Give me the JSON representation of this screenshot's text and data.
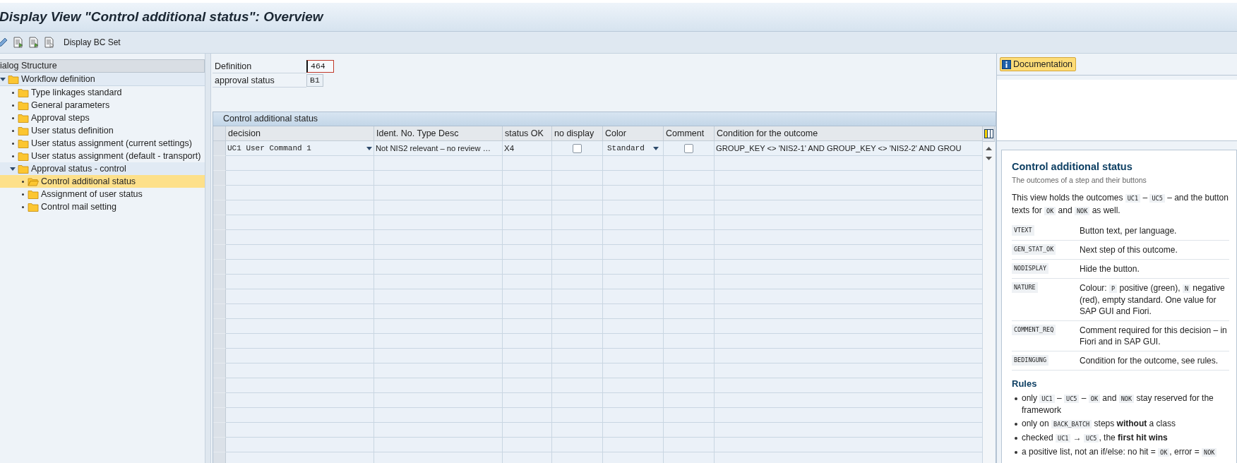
{
  "window": {
    "title": "Display View \"Control additional status\": Overview"
  },
  "toolbar": {
    "button": "Display BC Set"
  },
  "dialog_structure": {
    "title": "ialog Structure",
    "items": [
      {
        "label": "Workflow definition",
        "expanded": true,
        "selected": false,
        "children": [
          {
            "label": "Type linkages standard",
            "selected": false
          },
          {
            "label": "General parameters",
            "selected": false
          },
          {
            "label": "Approval steps",
            "selected": false
          },
          {
            "label": "User status definition",
            "selected": false
          },
          {
            "label": "User status assignment (current settings)",
            "selected": false
          },
          {
            "label": "User status assignment (default - transport)",
            "selected": false
          },
          {
            "label": "Approval status - control",
            "expanded": true,
            "selected": false,
            "children": [
              {
                "label": "Control additional status",
                "selected": true
              },
              {
                "label": "Assignment of user status",
                "selected": false
              },
              {
                "label": "Control mail setting",
                "selected": false
              }
            ]
          }
        ]
      }
    ]
  },
  "header_fields": [
    {
      "label": "Definition",
      "value": "464",
      "focused": true
    },
    {
      "label": "approval status",
      "value": "B1",
      "focused": false
    }
  ],
  "table": {
    "title": "Control additional status",
    "columns": [
      "decision",
      "Ident. No. Type Desc",
      "status OK",
      "no display",
      "Color",
      "Comment",
      "Condition for the outcome"
    ],
    "rows": [
      {
        "decision": "UC1 User Command 1",
        "ident": "Not NIS2 relevant – no review …",
        "status_ok": "X4",
        "no_display": false,
        "color_option": "Standard",
        "comment": false,
        "condition": "GROUP_KEY <> 'NIS2-1' AND GROUP_KEY <> 'NIS2-2' AND GROU"
      }
    ]
  },
  "documentation": {
    "button": "Documentation",
    "title": "Control additional status",
    "subtitle": "The outcomes of a step and their buttons",
    "intro": [
      {
        "kind": "text",
        "text": "This view holds the outcomes "
      },
      {
        "kind": "code",
        "text": "UC1"
      },
      {
        "kind": "text",
        "text": " – "
      },
      {
        "kind": "code",
        "text": "UC5"
      },
      {
        "kind": "text",
        "text": " – and the button texts for "
      },
      {
        "kind": "code",
        "text": "OK"
      },
      {
        "kind": "text",
        "text": " and "
      },
      {
        "kind": "code",
        "text": "NOK"
      },
      {
        "kind": "text",
        "text": " as well."
      }
    ],
    "fields": [
      {
        "code": "VTEXT",
        "desc": [
          {
            "kind": "text",
            "text": "Button text, per language."
          }
        ]
      },
      {
        "code": "GEN_STAT_OK",
        "desc": [
          {
            "kind": "text",
            "text": "Next step of this outcome."
          }
        ]
      },
      {
        "code": "NODISPLAY",
        "desc": [
          {
            "kind": "text",
            "text": "Hide the button."
          }
        ]
      },
      {
        "code": "NATURE",
        "desc": [
          {
            "kind": "text",
            "text": "Colour: "
          },
          {
            "kind": "code",
            "text": "P"
          },
          {
            "kind": "text",
            "text": " positive (green), "
          },
          {
            "kind": "code",
            "text": "N"
          },
          {
            "kind": "text",
            "text": " negative (red), empty standard. One value for SAP GUI and Fiori."
          }
        ]
      },
      {
        "code": "COMMENT_REQ",
        "desc": [
          {
            "kind": "text",
            "text": "Comment required for this decision – in Fiori and in SAP GUI."
          }
        ]
      },
      {
        "code": "BEDINGUNG",
        "desc": [
          {
            "kind": "text",
            "text": "Condition for the outcome, see rules."
          }
        ]
      }
    ],
    "rules_title": "Rules",
    "rules": [
      [
        {
          "kind": "text",
          "text": "only "
        },
        {
          "kind": "code",
          "text": "UC1"
        },
        {
          "kind": "text",
          "text": " – "
        },
        {
          "kind": "code",
          "text": "UC5"
        },
        {
          "kind": "text",
          "text": " – "
        },
        {
          "kind": "code",
          "text": "OK"
        },
        {
          "kind": "text",
          "text": " and "
        },
        {
          "kind": "code",
          "text": "NOK"
        },
        {
          "kind": "text",
          "text": " stay reserved for the framework"
        }
      ],
      [
        {
          "kind": "text",
          "text": "only on "
        },
        {
          "kind": "code",
          "text": "BACK_BATCH"
        },
        {
          "kind": "text",
          "text": " steps "
        },
        {
          "kind": "bold",
          "text": "without"
        },
        {
          "kind": "text",
          "text": " a class"
        }
      ],
      [
        {
          "kind": "text",
          "text": "checked "
        },
        {
          "kind": "code",
          "text": "UC1"
        },
        {
          "kind": "text",
          "text": " → "
        },
        {
          "kind": "code",
          "text": "UC5"
        },
        {
          "kind": "text",
          "text": ", the "
        },
        {
          "kind": "bold",
          "text": "first hit wins"
        }
      ],
      [
        {
          "kind": "text",
          "text": "a positive list, not an if/else: no hit = "
        },
        {
          "kind": "code",
          "text": "OK"
        },
        {
          "kind": "text",
          "text": ", error = "
        },
        {
          "kind": "code",
          "text": "NOK"
        }
      ]
    ]
  }
}
